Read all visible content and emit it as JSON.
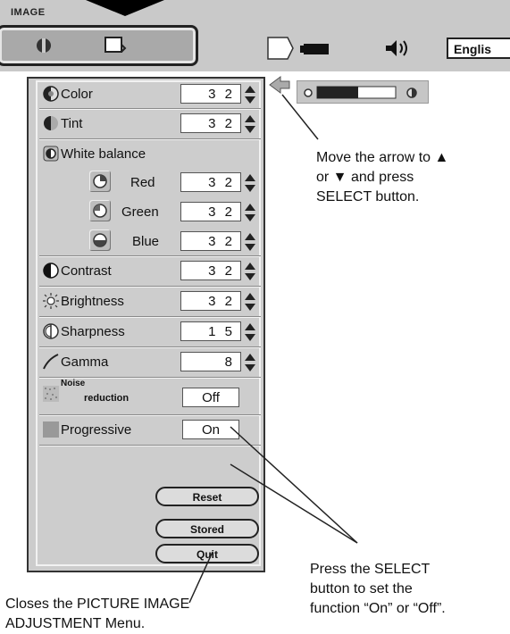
{
  "menu": {
    "tab_label": "IMAGE",
    "language_value": "Englis"
  },
  "panel": {
    "rows": [
      {
        "label": "Color",
        "value": "3 2"
      },
      {
        "label": "Tint",
        "value": "3 2"
      },
      {
        "label": "White balance"
      },
      {
        "label": "Red",
        "value": "3 2"
      },
      {
        "label": "Green",
        "value": "3 2"
      },
      {
        "label": "Blue",
        "value": "3 2"
      },
      {
        "label": "Contrast",
        "value": "3 2"
      },
      {
        "label": "Brightness",
        "value": "3 2"
      },
      {
        "label": "Sharpness",
        "value": "1 5"
      },
      {
        "label": "Gamma",
        "value": "8"
      },
      {
        "label_line1": "Noise",
        "label_line2": "reduction",
        "value": "Off"
      },
      {
        "label": "Progressive",
        "value": "On"
      }
    ],
    "buttons": {
      "reset": "Reset",
      "stored": "Stored",
      "quit": "Quit"
    }
  },
  "callouts": {
    "arrow_line1": "Move the arrow to ▲",
    "arrow_line2": "or ▼  and press",
    "arrow_line3": "SELECT button.",
    "select_line1": "Press the SELECT",
    "select_line2": "button to set the",
    "select_line3": "function “On” or “Off”.",
    "closes_line1": "Closes the PICTURE IMAGE",
    "closes_line2": "ADJUSTMENT Menu."
  },
  "colors": {
    "panel": "#cdcdcd",
    "menubar": "#c9c9c9",
    "accent": "#222222"
  }
}
